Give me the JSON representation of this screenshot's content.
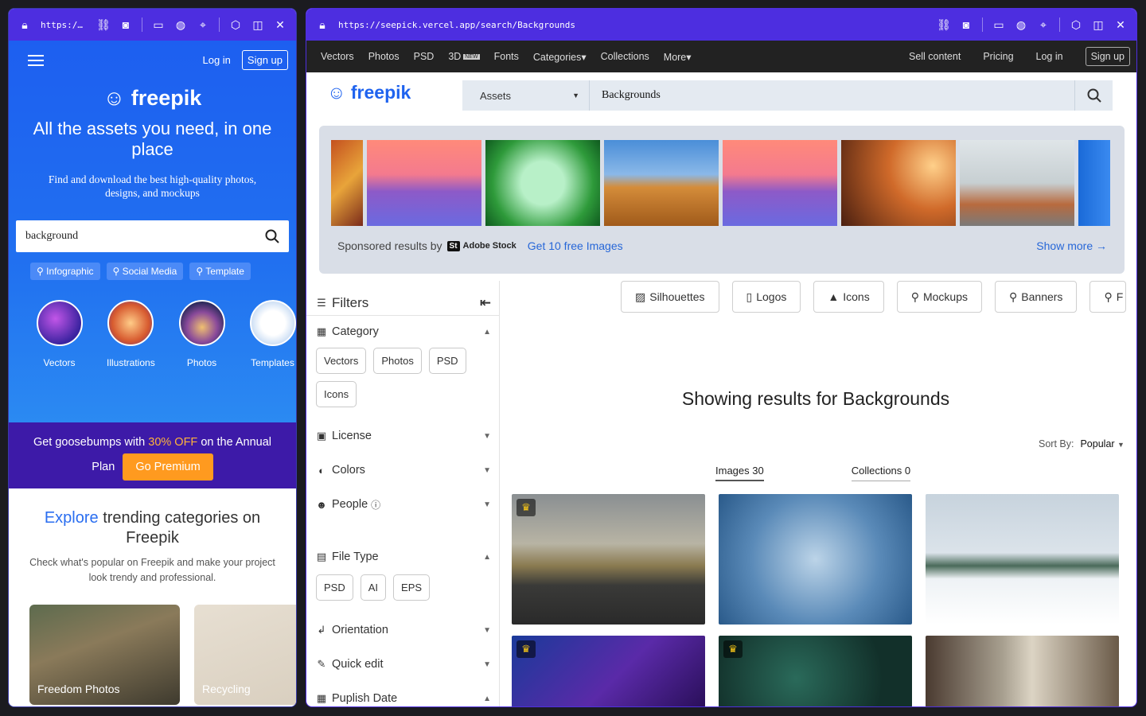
{
  "left": {
    "url": "https:/…",
    "header": {
      "login": "Log in",
      "signup": "Sign up"
    },
    "logo": "freepik",
    "title": "All the assets you need, in one place",
    "subtitle": "Find and download the best high-quality photos, designs, and mockups",
    "search_value": "background",
    "chips": [
      "Infographic",
      "Social Media",
      "Template"
    ],
    "categories": [
      "Vectors",
      "Illustrations",
      "Photos",
      "Templates"
    ],
    "promo": {
      "pre": "Get goosebumps with",
      "pct": "30% OFF",
      "post": "on the Annual",
      "plan": "Plan",
      "button": "Go Premium"
    },
    "explore": {
      "blue": "Explore",
      "rest": "trending categories on Freepik",
      "desc": "Check what's popular on Freepik and make your project look trendy and professional."
    },
    "tiles": [
      "Freedom Photos",
      "Recycling"
    ]
  },
  "right": {
    "url": "https://seepick.vercel.app/search/Backgrounds",
    "nav": {
      "items": [
        "Vectors",
        "Photos",
        "PSD",
        "3D",
        "Fonts",
        "Categories",
        "Collections",
        "More"
      ],
      "new_badge": "NEW",
      "sell": "Sell content",
      "pricing": "Pricing",
      "login": "Log in",
      "signup": "Sign up"
    },
    "logo": "freepik",
    "search": {
      "category": "Assets",
      "value": "Backgrounds"
    },
    "sponsored": {
      "label": "Sponsored results by",
      "brand": "Adobe Stock",
      "badge": "St",
      "offer": "Get 10 free Images",
      "more": "Show more"
    },
    "filters": {
      "title": "Filters",
      "category": "Category",
      "category_options": [
        "Vectors",
        "Photos",
        "PSD",
        "Icons"
      ],
      "license": "License",
      "colors": "Colors",
      "people": "People",
      "file_type": "File Type",
      "file_options": [
        "PSD",
        "AI",
        "EPS"
      ],
      "orientation": "Orientation",
      "quick_edit": "Quick edit",
      "publish_date": "Puplish Date"
    },
    "tags": [
      "Silhouettes",
      "Logos",
      "Icons",
      "Mockups",
      "Banners",
      "F"
    ],
    "showing": "Showing results for Backgrounds",
    "sort": {
      "label": "Sort By:",
      "value": "Popular"
    },
    "tabs": [
      "Images 30",
      "Collections 0"
    ]
  },
  "colors": {
    "titlebar": "#4d2ee0",
    "brand_blue": "#1f63ef",
    "premium_orange": "#ff9a1f"
  }
}
